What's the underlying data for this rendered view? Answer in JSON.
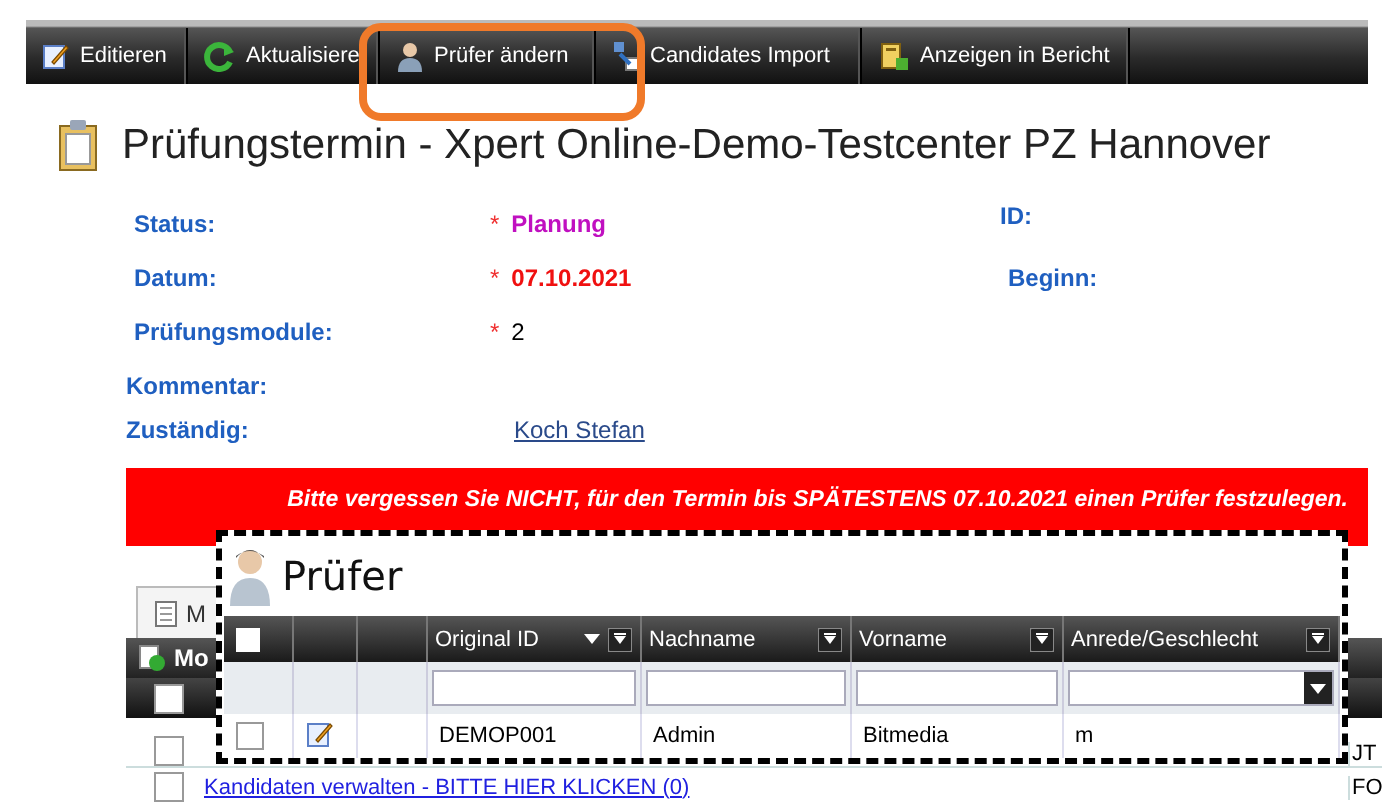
{
  "toolbar": [
    {
      "label": "Editieren",
      "kind": "edit"
    },
    {
      "label": "Aktualisiere",
      "kind": "refresh"
    },
    {
      "label": "Prüfer ändern",
      "kind": "person"
    },
    {
      "label": "Candidates Import",
      "kind": "import"
    },
    {
      "label": "Anzeigen in Bericht",
      "kind": "report"
    }
  ],
  "title": "Prüfungstermin - Xpert Online-Demo-Testcenter PZ Hannover",
  "fields": [
    {
      "label": "Status:",
      "marker": "*",
      "value": "Planung",
      "kind": "status",
      "side_label": "ID:"
    },
    {
      "label": "Datum:",
      "marker": "*",
      "value": "07.10.2021",
      "kind": "date",
      "side_label": "Beginn:"
    },
    {
      "label": "Prüfungsmodule:",
      "marker": "*",
      "value": "2",
      "kind": "plain"
    },
    {
      "label": "Kommentar:",
      "kind": "empty"
    },
    {
      "label": "Zuständig:",
      "value": "Koch Stefan",
      "kind": "link"
    }
  ],
  "banner": "Bitte vergessen Sie NICHT, für den Termin bis SPÄTESTENS 07.10.2021 einen Prüfer festzulegen.",
  "background": {
    "tab": "M",
    "header_checked": false,
    "grid_title": "Mo",
    "rows": [
      {
        "link": null,
        "column_3": "JT",
        "checked": false
      },
      {
        "link": "Kandidaten verwalten - BITTE HIER KLICKEN (0)",
        "column_3": "FO",
        "checked": false
      }
    ]
  },
  "popup": {
    "title": "Prüfer",
    "header_checked": false,
    "columns": [
      {
        "label": "Original ID",
        "sorted": true,
        "kind": "text"
      },
      {
        "label": "Nachname",
        "sorted": false,
        "kind": "text"
      },
      {
        "label": "Vorname",
        "sorted": false,
        "kind": "text"
      },
      {
        "label": "Anrede/Geschlecht",
        "sorted": false,
        "kind": "select"
      }
    ],
    "rows": [
      {
        "checked": false,
        "cells": [
          "DEMOP001",
          "Admin",
          "Bitmedia",
          "m"
        ]
      }
    ]
  }
}
